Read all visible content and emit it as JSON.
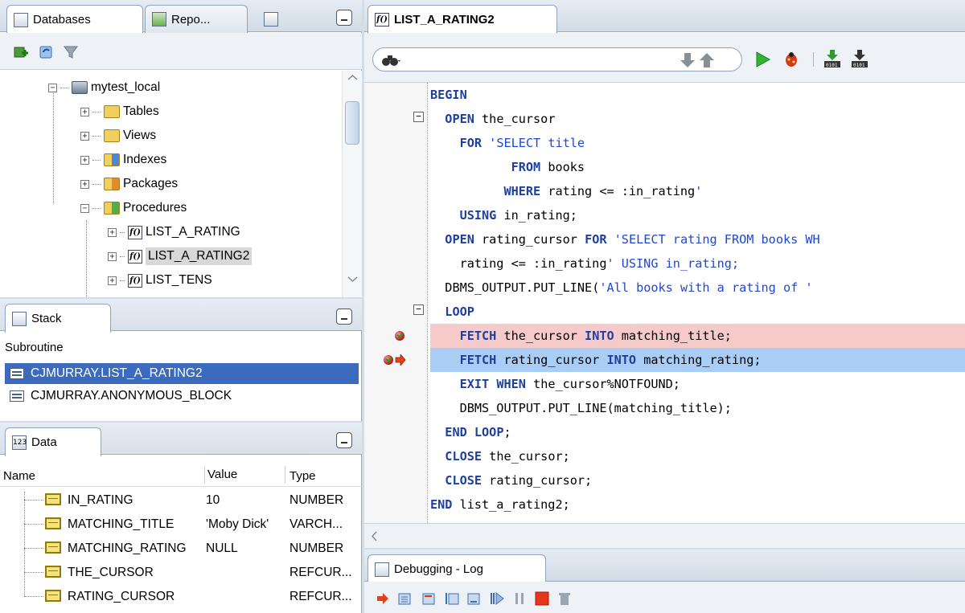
{
  "databases_panel": {
    "tabs": [
      {
        "label": "Databases",
        "icon": "database-icon"
      },
      {
        "label": "Repo...",
        "icon": "report-icon"
      },
      {
        "label": "",
        "icon": "document-icon"
      }
    ],
    "toolbar": [
      "add-connection-icon",
      "refresh-icon",
      "filter-icon"
    ],
    "tree": {
      "connection": "mytest_local",
      "folders": [
        "Tables",
        "Views",
        "Indexes",
        "Packages",
        "Procedures"
      ],
      "procedures": [
        "LIST_A_RATING",
        "LIST_A_RATING2",
        "LIST_TENS"
      ],
      "selected_procedure": "LIST_A_RATING2"
    }
  },
  "stack_panel": {
    "tab_label": "Stack",
    "column_header": "Subroutine",
    "rows": [
      "CJMURRAY.LIST_A_RATING2",
      "CJMURRAY.ANONYMOUS_BLOCK"
    ],
    "selected_index": 0
  },
  "data_panel": {
    "tab_label": "Data",
    "columns": [
      "Name",
      "Value",
      "Type"
    ],
    "rows": [
      {
        "name": "IN_RATING",
        "value": "10",
        "type": "NUMBER"
      },
      {
        "name": "MATCHING_TITLE",
        "value": "'Moby Dick'",
        "type": "VARCH..."
      },
      {
        "name": "MATCHING_RATING",
        "value": "NULL",
        "type": "NUMBER"
      },
      {
        "name": "THE_CURSOR",
        "value": "",
        "type": "REFCUR..."
      },
      {
        "name": "RATING_CURSOR",
        "value": "",
        "type": "REFCUR..."
      }
    ]
  },
  "editor": {
    "tab_label": "LIST_A_RATING2",
    "search_icon": "binoculars-icon",
    "toolbar": [
      "down-arrow-icon",
      "up-arrow-icon",
      "run-icon",
      "debug-icon",
      "compile-icon",
      "compile-debug-icon"
    ],
    "code": [
      "BEGIN",
      "  OPEN the_cursor",
      "    FOR 'SELECT title",
      "           FROM books",
      "          WHERE rating <= :in_rating'",
      "    USING in_rating;",
      "  OPEN rating_cursor FOR 'SELECT rating FROM books WH",
      "    rating <= :in_rating' USING in_rating;",
      "  DBMS_OUTPUT.PUT_LINE('All books with a rating of '",
      "  LOOP",
      "    FETCH the_cursor INTO matching_title;",
      "    FETCH rating_cursor INTO matching_rating;",
      "    EXIT WHEN the_cursor%NOTFOUND;",
      "    DBMS_OUTPUT.PUT_LINE(matching_title);",
      "  END LOOP;",
      "  CLOSE the_cursor;",
      "  CLOSE rating_cursor;",
      "END list_a_rating2;"
    ],
    "breakpoint_line": 10,
    "execution_line": 11
  },
  "log_panel": {
    "tab_label": "Debugging - Log",
    "toolbar": [
      "find-execution-point-icon",
      "step-over-icon",
      "step-into-icon",
      "step-out-icon",
      "step-to-end-icon",
      "resume-icon",
      "pause-icon",
      "terminate-icon",
      "garbage-collect-icon"
    ]
  },
  "colors": {
    "selection": "#3c6bbd",
    "breakpoint_line": "#f7caca",
    "execution_line": "#a9cdf5",
    "keyword": "#1f3f9c"
  }
}
